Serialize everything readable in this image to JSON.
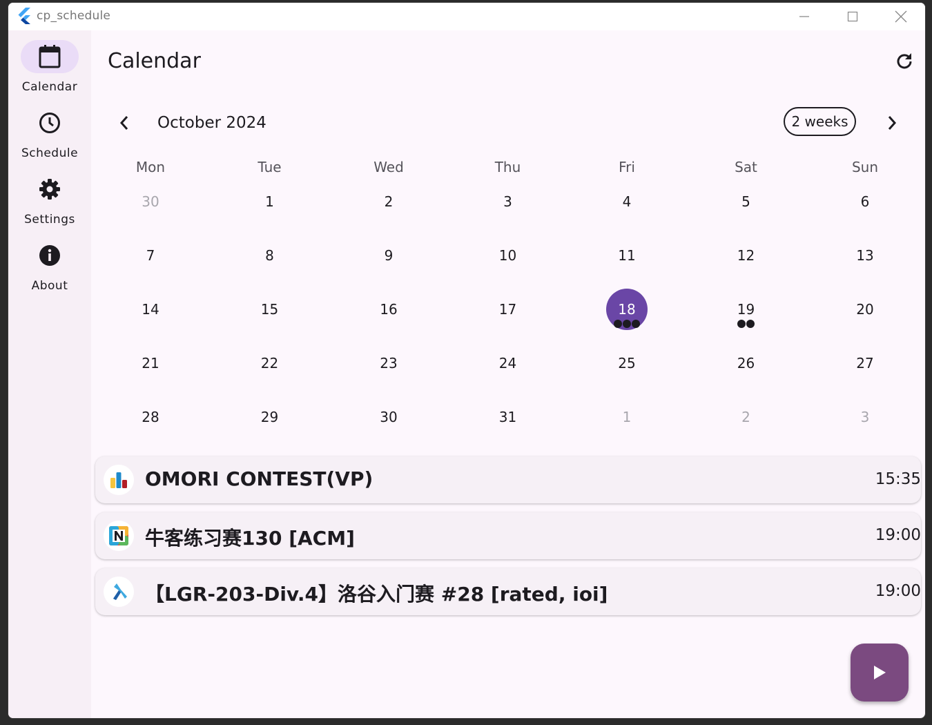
{
  "window": {
    "title": "cp_schedule",
    "controls": [
      "minimize-icon",
      "maximize-icon",
      "close-icon"
    ]
  },
  "rail": {
    "items": [
      {
        "label": "Calendar",
        "icon": "calendar-icon",
        "active": true
      },
      {
        "label": "Schedule",
        "icon": "clock-icon",
        "active": false
      },
      {
        "label": "Settings",
        "icon": "gear-icon",
        "active": false
      },
      {
        "label": "About",
        "icon": "info-icon",
        "active": false
      }
    ]
  },
  "header": {
    "title": "Calendar",
    "refresh_icon": "refresh-icon"
  },
  "calendar": {
    "month_label": "October 2024",
    "format_button": "2 weeks",
    "days_of_week": [
      "Mon",
      "Tue",
      "Wed",
      "Thu",
      "Fri",
      "Sat",
      "Sun"
    ],
    "weeks": [
      [
        {
          "n": "30",
          "out": true
        },
        {
          "n": "1"
        },
        {
          "n": "2"
        },
        {
          "n": "3"
        },
        {
          "n": "4"
        },
        {
          "n": "5"
        },
        {
          "n": "6"
        }
      ],
      [
        {
          "n": "7"
        },
        {
          "n": "8"
        },
        {
          "n": "9"
        },
        {
          "n": "10"
        },
        {
          "n": "11"
        },
        {
          "n": "12"
        },
        {
          "n": "13"
        }
      ],
      [
        {
          "n": "14"
        },
        {
          "n": "15"
        },
        {
          "n": "16"
        },
        {
          "n": "17"
        },
        {
          "n": "18",
          "today": true,
          "events": 3
        },
        {
          "n": "19",
          "events": 2
        },
        {
          "n": "20"
        }
      ],
      [
        {
          "n": "21"
        },
        {
          "n": "22"
        },
        {
          "n": "23"
        },
        {
          "n": "24"
        },
        {
          "n": "25"
        },
        {
          "n": "26"
        },
        {
          "n": "27"
        }
      ],
      [
        {
          "n": "28"
        },
        {
          "n": "29"
        },
        {
          "n": "30"
        },
        {
          "n": "31"
        },
        {
          "n": "1",
          "out": true
        },
        {
          "n": "2",
          "out": true
        },
        {
          "n": "3",
          "out": true
        }
      ]
    ]
  },
  "events": [
    {
      "title": "OMORI CONTEST(VP)",
      "time": "15:35",
      "logo": "codeforces-logo-icon"
    },
    {
      "title": "牛客练习赛130 [ACM]",
      "time": "19:00",
      "logo": "nowcoder-logo-icon"
    },
    {
      "title": "【LGR-203-Div.4】洛谷入门赛 #28 [rated, ioi]",
      "time": "19:00",
      "logo": "luogu-logo-icon"
    }
  ],
  "fab": {
    "icon": "play-icon"
  },
  "colors": {
    "accent": "#6a46a6",
    "fab": "#7b4a80",
    "rail_active": "#eadcf7",
    "background": "#fdf7fd"
  }
}
